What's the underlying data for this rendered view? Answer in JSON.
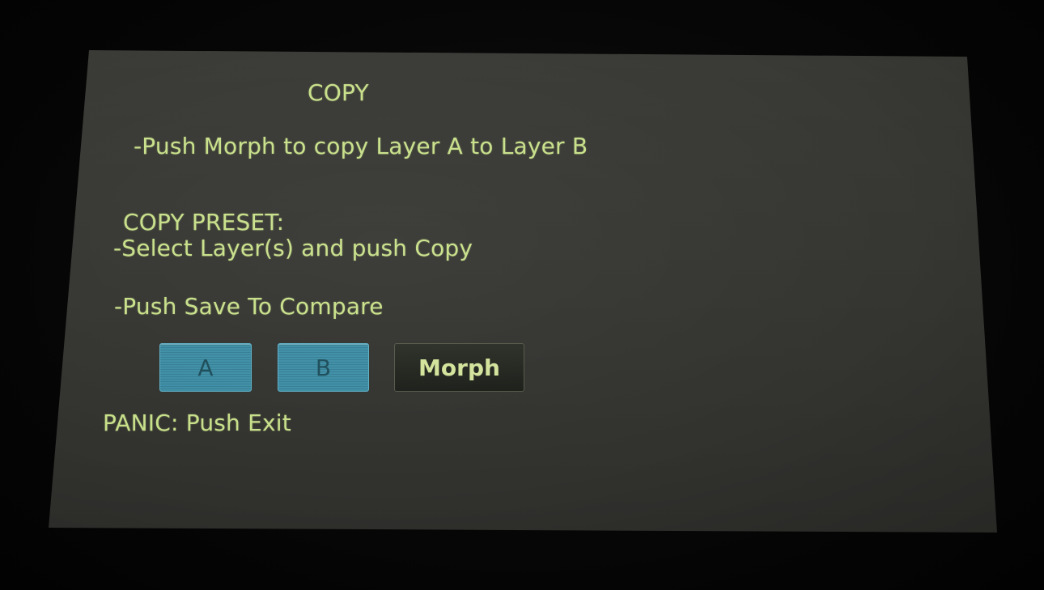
{
  "screen": {
    "title": "COPY",
    "instruction_morph": "-Push Morph to copy Layer A to Layer B",
    "copy_preset_heading": "COPY PRESET:",
    "copy_preset_instruction": "-Select Layer(s) and push Copy",
    "compare_instruction": "-Push Save To Compare",
    "panic_text": "PANIC: Push Exit"
  },
  "buttons": {
    "layer_a": "A",
    "layer_b": "B",
    "morph": "Morph"
  },
  "colors": {
    "text": "#c8e08a",
    "layer_button": "#3f8fa6",
    "morph_button": "#1c1f19",
    "screen_background": "#363632"
  }
}
